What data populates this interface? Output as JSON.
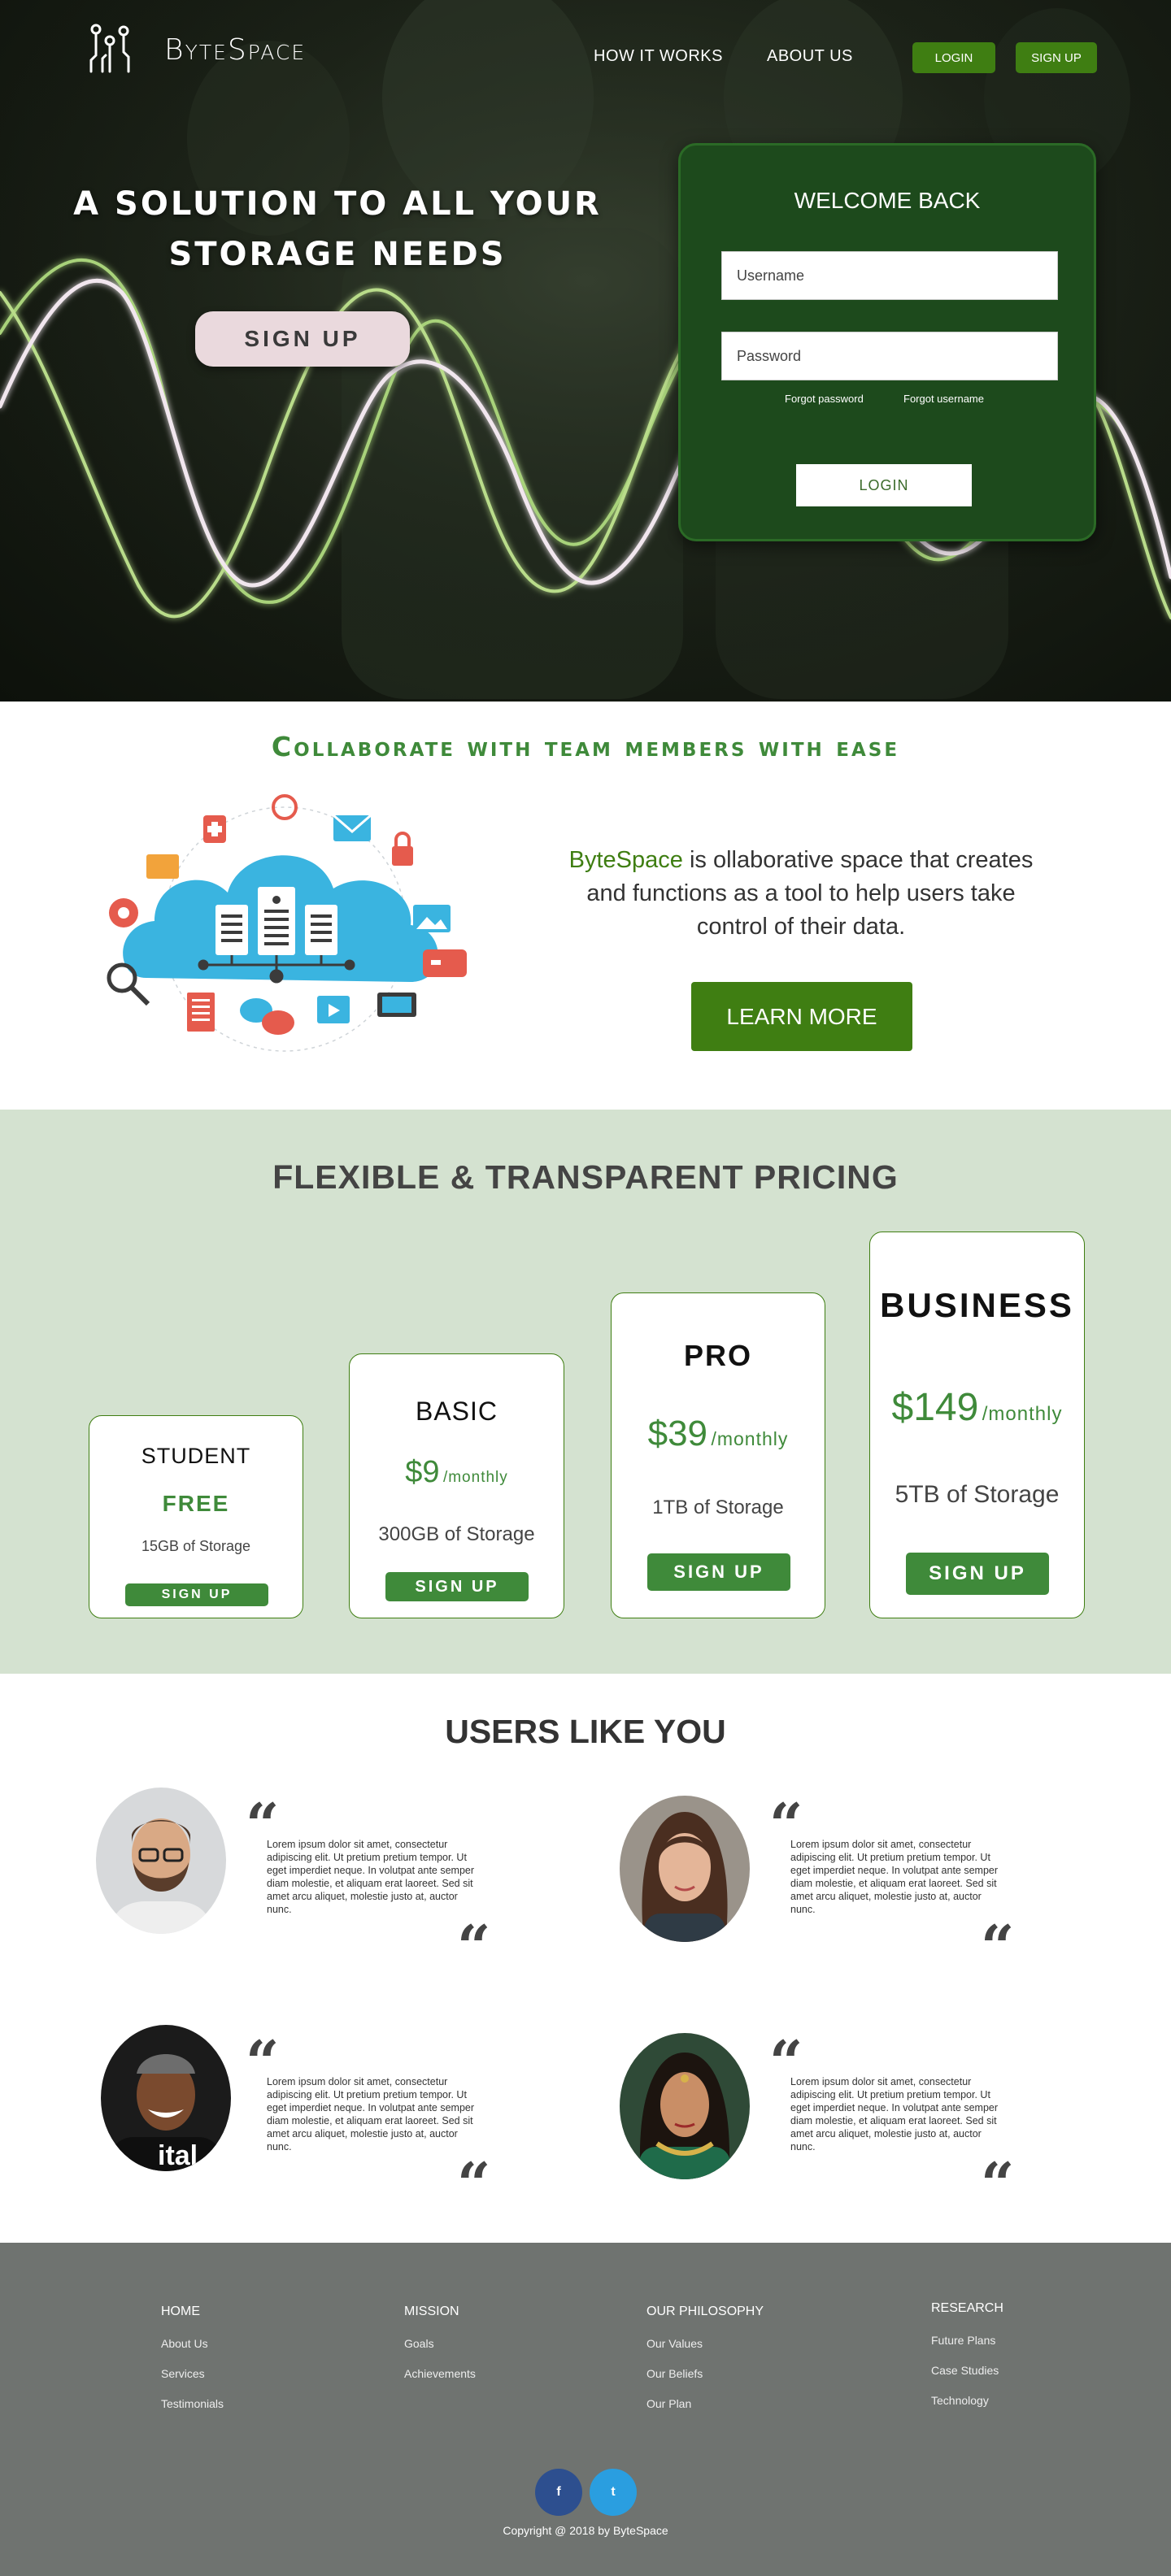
{
  "brand": {
    "name": "ByteSpace",
    "accent": "#3f7e12",
    "dark_green": "#1d4a1c"
  },
  "nav": {
    "links": [
      "HOW IT WORKS",
      "ABOUT US"
    ],
    "login_label": "LOGIN",
    "signup_label": "SIGN UP"
  },
  "hero": {
    "title_line1": "A SOLUTION TO ALL YOUR",
    "title_line2": "STORAGE NEEDS",
    "signup_label": "SIGN UP"
  },
  "login_card": {
    "title": "WELCOME BACK",
    "username_placeholder": "Username",
    "password_placeholder": "Password",
    "forgot_password": "Forgot password",
    "forgot_username": "Forgot username",
    "login_label": "LOGIN"
  },
  "collaborate": {
    "title": "Collaborate with team members with ease",
    "brand_word": "ByteSpace",
    "description": " is ollaborative space that creates and functions as a tool to help users take control of their data.",
    "learn_more_label": "LEARN MORE"
  },
  "pricing": {
    "title": "FLEXIBLE & TRANSPARENT PRICING",
    "plans": [
      {
        "name": "STUDENT",
        "price": "FREE",
        "per": "",
        "storage": "15GB of Storage",
        "button": "SIGN UP"
      },
      {
        "name": "BASIC",
        "price": "$9",
        "per": "/monthly",
        "storage": "300GB of Storage",
        "button": "SIGN UP"
      },
      {
        "name": "PRO",
        "price": "$39",
        "per": "/monthly",
        "storage": "1TB of Storage",
        "button": "SIGN UP"
      },
      {
        "name": "BUSINESS",
        "price": "$149",
        "per": "/monthly",
        "storage": "5TB of Storage",
        "button": "SIGN UP"
      }
    ]
  },
  "testimonials": {
    "title": "USERS LIKE YOU",
    "items": [
      {
        "text": "Lorem ipsum dolor sit amet, consectetur adipiscing elit. Ut pretium pretium tempor. Ut eget imperdiet neque. In volutpat ante semper diam molestie, et aliquam erat laoreet. Sed sit amet arcu aliquet, molestie justo at, auctor nunc."
      },
      {
        "text": "Lorem ipsum dolor sit amet, consectetur adipiscing elit. Ut pretium pretium tempor. Ut eget imperdiet neque. In volutpat ante semper diam molestie, et aliquam erat laoreet. Sed sit amet arcu aliquet, molestie justo at, auctor nunc."
      },
      {
        "text": "Lorem ipsum dolor sit amet, consectetur adipiscing elit. Ut pretium pretium tempor. Ut eget imperdiet neque. In volutpat ante semper diam molestie, et aliquam erat laoreet. Sed sit amet arcu aliquet, molestie justo at, auctor nunc."
      },
      {
        "text": "Lorem ipsum dolor sit amet, consectetur adipiscing elit. Ut pretium pretium tempor. Ut eget imperdiet neque. In volutpat ante semper diam molestie, et aliquam erat laoreet. Sed sit amet arcu aliquet, molestie justo at, auctor nunc."
      }
    ],
    "shirt_text": "ital"
  },
  "footer": {
    "columns": [
      {
        "heading": "HOME",
        "links": [
          "About Us",
          "Services",
          "Testimonials"
        ]
      },
      {
        "heading": "MISSION",
        "links": [
          "Goals",
          "Achievements"
        ]
      },
      {
        "heading": "OUR PHILOSOPHY",
        "links": [
          "Our Values",
          "Our Beliefs",
          "Our Plan"
        ]
      },
      {
        "heading": "RESEARCH",
        "links": [
          "Future Plans",
          "Case Studies",
          "Technology"
        ]
      }
    ],
    "social": {
      "facebook": "f",
      "twitter": "t"
    },
    "copyright": "Copyright @ 2018 by ByteSpace"
  }
}
